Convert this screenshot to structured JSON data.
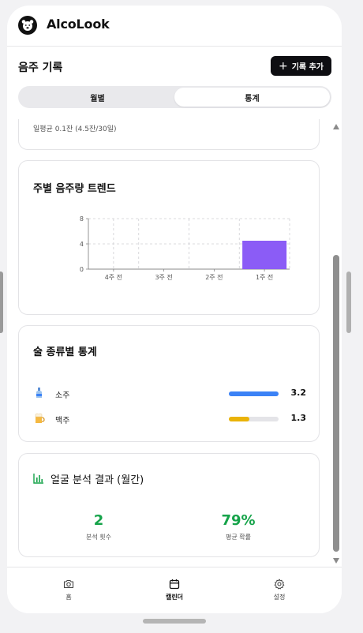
{
  "app": {
    "title": "AlcoLook",
    "logo_icon": "bear-face-icon"
  },
  "page": {
    "title": "음주 기록",
    "add_button": "기록 추가"
  },
  "segments": {
    "monthly": "월별",
    "stats": "통계",
    "selected": "통계"
  },
  "summary": {
    "avg_text": "일평균 0.1잔 (4.5잔/30일)"
  },
  "trend": {
    "title": "주별 음주량 트렌드",
    "chart_data": {
      "type": "bar",
      "categories": [
        "4주 전",
        "3주 전",
        "2주 전",
        "1주 전"
      ],
      "values": [
        0,
        0,
        0,
        4.5
      ],
      "ylim": [
        0,
        8
      ],
      "yticks": [
        "0",
        "4",
        "8"
      ],
      "grid": true,
      "bar_color": "#8b5cf6"
    }
  },
  "types": {
    "title": "술 종류별 통계",
    "items": [
      {
        "label": "소주",
        "value": "3.2",
        "fill_fraction": 1.0,
        "color": "#3b82f6",
        "icon": "soju-bottle-icon"
      },
      {
        "label": "맥주",
        "value": "1.3",
        "fill_fraction": 0.41,
        "color": "#eab308",
        "icon": "beer-mug-icon"
      }
    ]
  },
  "face": {
    "title": "얼굴 분석 결과 (월간)",
    "icon": "bar-chart-icon",
    "accent": "#16a34a",
    "count_value": "2",
    "count_label": "분석 횟수",
    "prob_value": "79%",
    "prob_label": "평균 확률"
  },
  "tabs": [
    {
      "label": "홈",
      "icon": "camera-icon"
    },
    {
      "label": "캘린더",
      "icon": "calendar-icon",
      "active": true
    },
    {
      "label": "설정",
      "icon": "gear-icon"
    }
  ]
}
